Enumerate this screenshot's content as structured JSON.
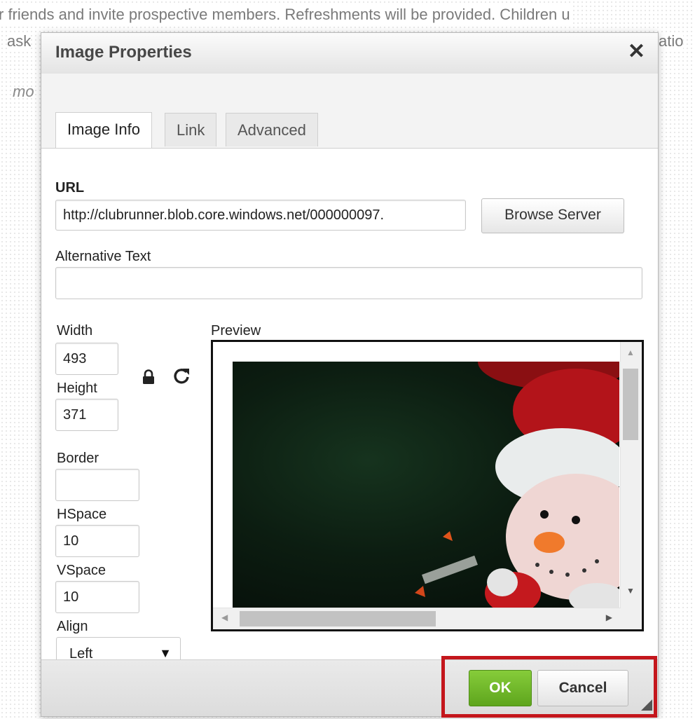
{
  "background": {
    "line1": "r friends and invite prospective members. Refreshments will be provided. Children u",
    "line2_left": "ask",
    "line2_right": "atio",
    "more": "mo"
  },
  "dialog": {
    "title": "Image Properties",
    "close_icon": "close-icon",
    "tabs": [
      {
        "label": "Image Info",
        "active": true
      },
      {
        "label": "Link",
        "active": false
      },
      {
        "label": "Advanced",
        "active": false
      }
    ]
  },
  "form": {
    "url_label": "URL",
    "url_value": "http://clubrunner.blob.core.windows.net/000000097.",
    "browse_server": "Browse Server",
    "alt_label": "Alternative Text",
    "alt_value": "",
    "width_label": "Width",
    "width_value": "493",
    "height_label": "Height",
    "height_value": "371",
    "lock_icon": "lock-icon",
    "reset_icon": "reset-size-icon",
    "border_label": "Border",
    "border_value": "",
    "hspace_label": "HSpace",
    "hspace_value": "10",
    "vspace_label": "VSpace",
    "vspace_value": "10",
    "align_label": "Align",
    "align_value": "Left",
    "align_arrow": "▼"
  },
  "preview": {
    "label": "Preview",
    "image_subject": "snowman-ornament-photo"
  },
  "footer": {
    "ok": "OK",
    "cancel": "Cancel"
  },
  "colors": {
    "ok_green": "#6cb52a",
    "highlight_red": "#c4161c",
    "active_field_border": "#5a9fd8"
  }
}
